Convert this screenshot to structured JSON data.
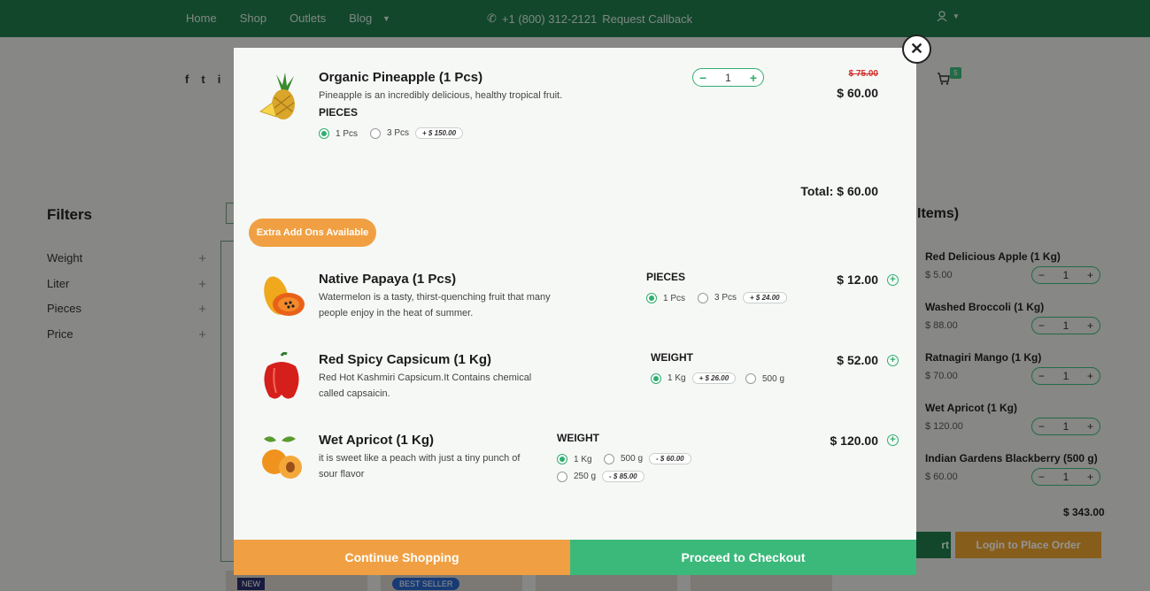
{
  "nav": {
    "items": [
      "Home",
      "Shop",
      "Outlets",
      "Blog"
    ],
    "phone": "+1 (800) 312-2121",
    "callback": "Request Callback"
  },
  "cart_badge": "5",
  "filters": {
    "title": "Filters",
    "items": [
      "Weight",
      "Liter",
      "Pieces",
      "Price"
    ]
  },
  "cart_panel": {
    "title": "Items)",
    "items": [
      {
        "name": "Red Delicious Apple (1 Kg)",
        "price": "$ 5.00",
        "qty": "1"
      },
      {
        "name": "Washed Broccoli (1 Kg)",
        "price": "$ 88.00",
        "qty": "1"
      },
      {
        "name": "Ratnagiri Mango (1 Kg)",
        "price": "$ 70.00",
        "qty": "1"
      },
      {
        "name": "Wet Apricot (1 Kg)",
        "price": "$ 120.00",
        "qty": "1"
      },
      {
        "name": "Indian Gardens Blackberry (500 g)",
        "price": "$ 60.00",
        "qty": "1"
      }
    ],
    "total": "$ 343.00",
    "btn_partial": "rt",
    "login_btn": "Login to Place Order"
  },
  "tags": {
    "new": "NEW",
    "best": "BEST SELLER"
  },
  "modal": {
    "main": {
      "title": "Organic Pineapple (1 Pcs)",
      "desc": "Pineapple is an incredibly delicious, healthy tropical fruit.",
      "group": "PIECES",
      "opt1": "1 Pcs",
      "opt2": "3 Pcs",
      "opt2_price": "+ $ 150.00",
      "qty": "1",
      "old_price": "$ 75.00",
      "price": "$ 60.00",
      "total": "Total: $ 60.00"
    },
    "addons_btn": "Extra Add Ons Available",
    "addons": [
      {
        "title": "Native Papaya (1 Pcs)",
        "desc": "Watermelon is a tasty, thirst-quenching fruit that many people enjoy in the heat of summer.",
        "group": "PIECES",
        "opt1": "1 Pcs",
        "opt2": "3 Pcs",
        "opt2_price": "+ $ 24.00",
        "price": "$ 12.00"
      },
      {
        "title": "Red Spicy Capsicum (1 Kg)",
        "desc": "Red Hot Kashmiri Capsicum.It Contains chemical called capsaicin.",
        "group": "WEIGHT",
        "opt1": "1 Kg",
        "opt1_price": "+ $ 26.00",
        "opt2": "500 g",
        "price": "$ 52.00"
      },
      {
        "title": "Wet Apricot (1 Kg)",
        "desc": "it is sweet like a peach with just a tiny punch of sour flavor",
        "group": "WEIGHT",
        "opt1": "1 Kg",
        "opt2": "500 g",
        "opt2_price": "- $ 60.00",
        "opt3": "250 g",
        "opt3_price": "- $ 85.00",
        "price": "$ 120.00"
      }
    ],
    "continue_btn": "Continue Shopping",
    "checkout_btn": "Proceed to Checkout"
  },
  "colors": {
    "brand_green": "#1f7a4a",
    "accent_green": "#3bb97a",
    "accent_orange": "#f0a042",
    "strike_red": "#d2322d"
  }
}
